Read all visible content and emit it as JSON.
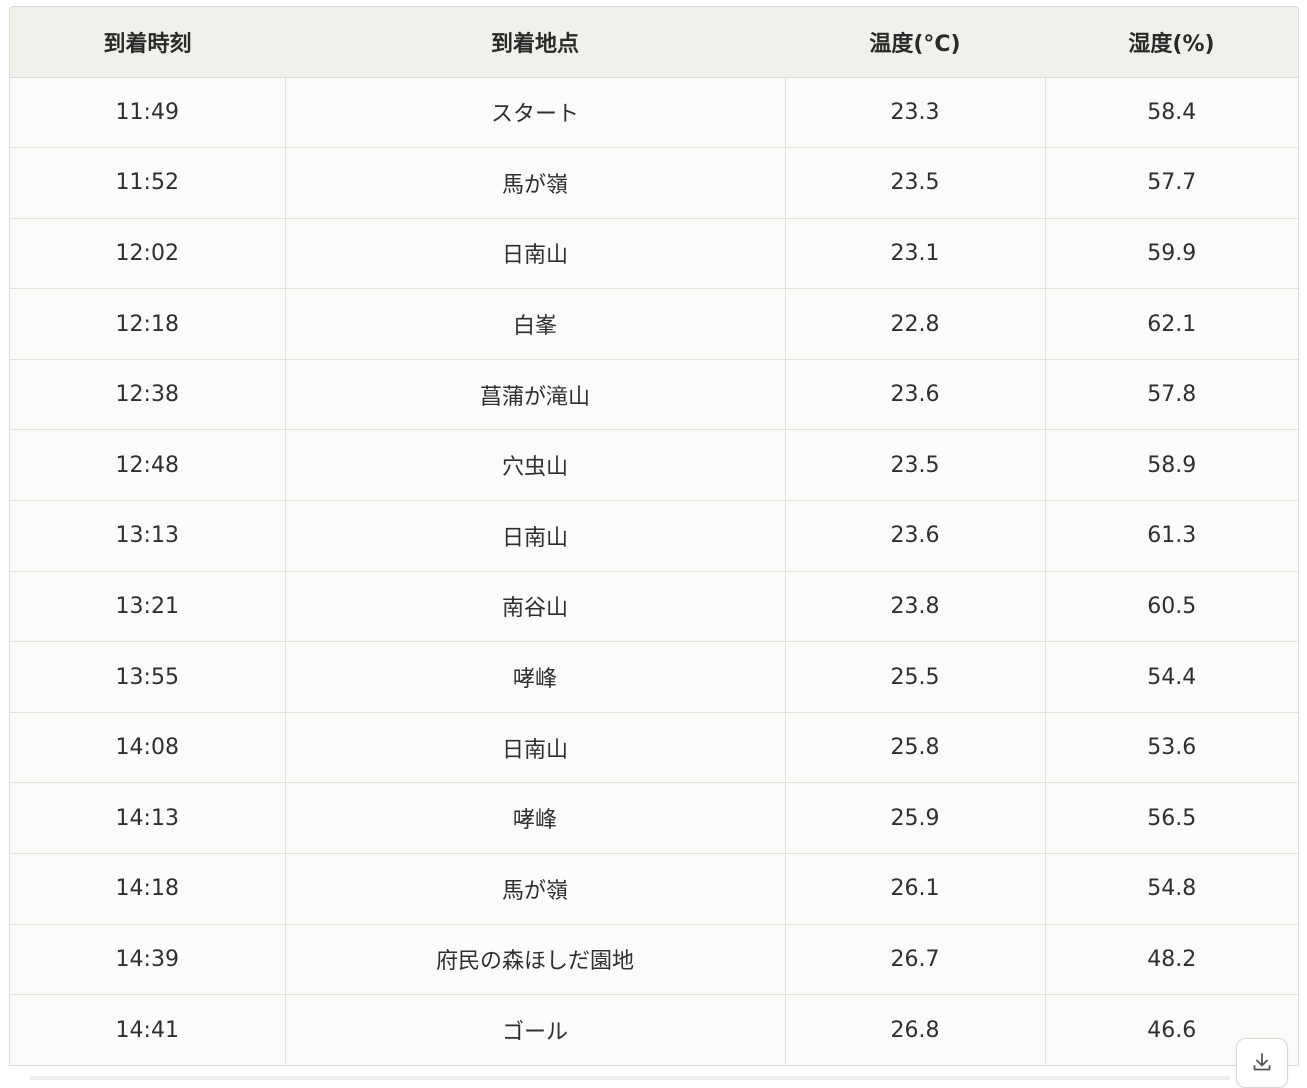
{
  "table": {
    "headers": [
      "到着時刻",
      "到着地点",
      "温度(°C)",
      "湿度(%)"
    ],
    "rows": [
      [
        "11:49",
        "スタート",
        "23.3",
        "58.4"
      ],
      [
        "11:52",
        "馬が嶺",
        "23.5",
        "57.7"
      ],
      [
        "12:02",
        "日南山",
        "23.1",
        "59.9"
      ],
      [
        "12:18",
        "白峯",
        "22.8",
        "62.1"
      ],
      [
        "12:38",
        "菖蒲が滝山",
        "23.6",
        "57.8"
      ],
      [
        "12:48",
        "穴虫山",
        "23.5",
        "58.9"
      ],
      [
        "13:13",
        "日南山",
        "23.6",
        "61.3"
      ],
      [
        "13:21",
        "南谷山",
        "23.8",
        "60.5"
      ],
      [
        "13:55",
        "哮峰",
        "25.5",
        "54.4"
      ],
      [
        "14:08",
        "日南山",
        "25.8",
        "53.6"
      ],
      [
        "14:13",
        "哮峰",
        "25.9",
        "56.5"
      ],
      [
        "14:18",
        "馬が嶺",
        "26.1",
        "54.8"
      ],
      [
        "14:39",
        "府民の森ほしだ園地",
        "26.7",
        "48.2"
      ],
      [
        "14:41",
        "ゴール",
        "26.8",
        "46.6"
      ]
    ]
  },
  "download_button": {
    "icon": "download-icon"
  },
  "colors": {
    "header_bg": "#f1f1ec",
    "body_bg": "#fbfbf9",
    "border": "#e2e2dc"
  }
}
